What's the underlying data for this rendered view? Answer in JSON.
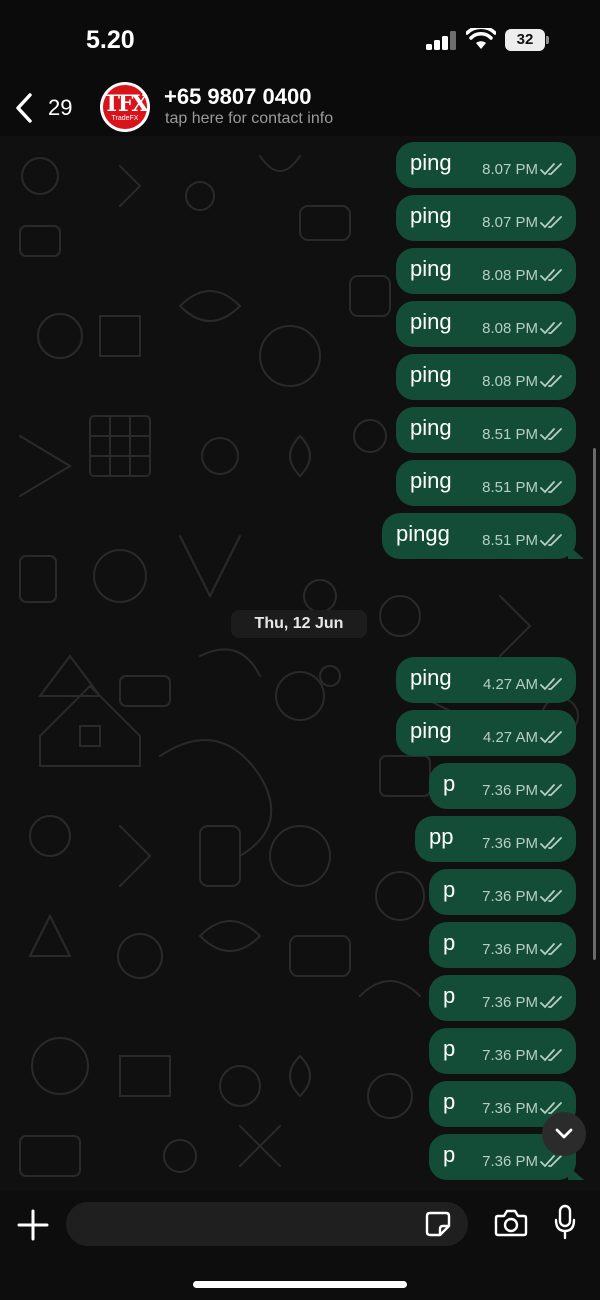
{
  "status_bar": {
    "time": "5.20",
    "battery": "32"
  },
  "header": {
    "back_count": "29",
    "avatar_logo": "TFX",
    "avatar_sub": "TradeFX",
    "contact_name": "+65 9807 0400",
    "contact_sub": "tap here for contact info"
  },
  "date_chip": "Thu, 12 Jun",
  "messages": [
    {
      "text": "ping",
      "time": "8.07 PM"
    },
    {
      "text": "ping",
      "time": "8.07 PM"
    },
    {
      "text": "ping",
      "time": "8.08 PM"
    },
    {
      "text": "ping",
      "time": "8.08 PM"
    },
    {
      "text": "ping",
      "time": "8.08 PM"
    },
    {
      "text": "ping",
      "time": "8.51 PM"
    },
    {
      "text": "ping",
      "time": "8.51 PM"
    },
    {
      "text": "pingg",
      "time": "8.51 PM"
    },
    {
      "text": "ping",
      "time": "4.27 AM"
    },
    {
      "text": "ping",
      "time": "4.27 AM"
    },
    {
      "text": "p",
      "time": "7.36 PM"
    },
    {
      "text": "pp",
      "time": "7.36 PM"
    },
    {
      "text": "p",
      "time": "7.36 PM"
    },
    {
      "text": "p",
      "time": "7.36 PM"
    },
    {
      "text": "p",
      "time": "7.36 PM"
    },
    {
      "text": "p",
      "time": "7.36 PM"
    },
    {
      "text": "p",
      "time": "7.36 PM"
    },
    {
      "text": "p",
      "time": "7.36 PM"
    }
  ],
  "colors": {
    "bubble": "#144d37",
    "background": "#101010",
    "ticks": "#b7cfc2",
    "avatar": "#d8131a"
  },
  "icons": [
    "back-chevron-icon",
    "signal-icon",
    "wifi-icon",
    "battery-icon",
    "double-check-icon",
    "chevron-down-icon",
    "plus-icon",
    "sticker-icon",
    "camera-icon",
    "mic-icon"
  ]
}
